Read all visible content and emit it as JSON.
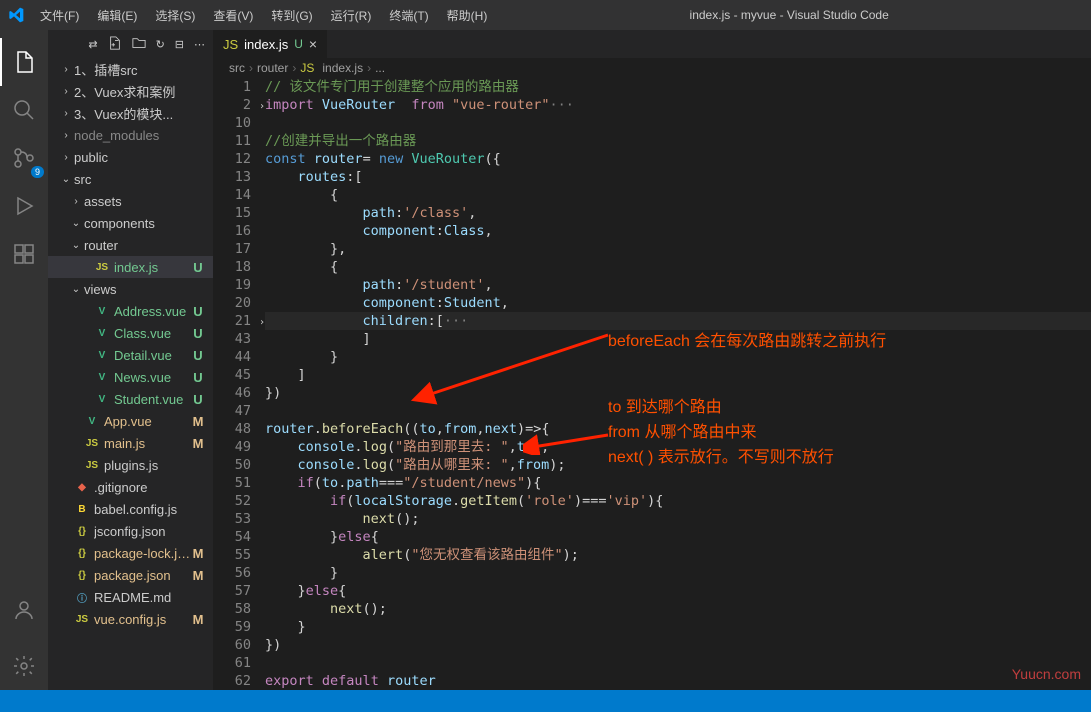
{
  "title": "index.js - myvue - Visual Studio Code",
  "menu": [
    "文件(F)",
    "编辑(E)",
    "选择(S)",
    "查看(V)",
    "转到(G)",
    "运行(R)",
    "终端(T)",
    "帮助(H)"
  ],
  "tab": {
    "label": "index.js",
    "status": "U"
  },
  "breadcrumb": [
    "src",
    "router",
    "index.js",
    "..."
  ],
  "tree": [
    {
      "d": 1,
      "chev": ">",
      "label": "1、插槽src",
      "kind": "folder"
    },
    {
      "d": 1,
      "chev": ">",
      "label": "2、Vuex求和案例",
      "kind": "folder"
    },
    {
      "d": 1,
      "chev": ">",
      "label": "3、Vuex的模块...",
      "kind": "folder"
    },
    {
      "d": 1,
      "chev": ">",
      "label": "node_modules",
      "kind": "folder",
      "dim": true
    },
    {
      "d": 1,
      "chev": ">",
      "label": "public",
      "kind": "folder"
    },
    {
      "d": 1,
      "chev": "v",
      "label": "src",
      "kind": "folder"
    },
    {
      "d": 2,
      "chev": ">",
      "label": "assets",
      "kind": "folder"
    },
    {
      "d": 2,
      "chev": "v",
      "label": "components",
      "kind": "folder"
    },
    {
      "d": 2,
      "chev": "v",
      "label": "router",
      "kind": "folder"
    },
    {
      "d": 3,
      "label": "index.js",
      "kind": "js",
      "st": "U",
      "sel": true
    },
    {
      "d": 2,
      "chev": "v",
      "label": "views",
      "kind": "folder"
    },
    {
      "d": 3,
      "label": "Address.vue",
      "kind": "vue",
      "st": "U"
    },
    {
      "d": 3,
      "label": "Class.vue",
      "kind": "vue",
      "st": "U"
    },
    {
      "d": 3,
      "label": "Detail.vue",
      "kind": "vue",
      "st": "U"
    },
    {
      "d": 3,
      "label": "News.vue",
      "kind": "vue",
      "st": "U"
    },
    {
      "d": 3,
      "label": "Student.vue",
      "kind": "vue",
      "st": "U"
    },
    {
      "d": 2,
      "label": "App.vue",
      "kind": "vue",
      "st": "M"
    },
    {
      "d": 2,
      "label": "main.js",
      "kind": "js",
      "st": "M"
    },
    {
      "d": 2,
      "label": "plugins.js",
      "kind": "js"
    },
    {
      "d": 1,
      "label": ".gitignore",
      "kind": "git"
    },
    {
      "d": 1,
      "label": "babel.config.js",
      "kind": "bab"
    },
    {
      "d": 1,
      "label": "jsconfig.json",
      "kind": "json"
    },
    {
      "d": 1,
      "label": "package-lock.json",
      "kind": "json",
      "st": "M"
    },
    {
      "d": 1,
      "label": "package.json",
      "kind": "json",
      "st": "M"
    },
    {
      "d": 1,
      "label": "README.md",
      "kind": "readme"
    },
    {
      "d": 1,
      "label": "vue.config.js",
      "kind": "js",
      "st": "M"
    }
  ],
  "lineNumbers": [
    "1",
    "2",
    "10",
    "11",
    "12",
    "13",
    "14",
    "15",
    "16",
    "17",
    "18",
    "19",
    "20",
    "21",
    "43",
    "44",
    "45",
    "46",
    "47",
    "48",
    "49",
    "50",
    "51",
    "52",
    "53",
    "54",
    "55",
    "56",
    "57",
    "58",
    "59",
    "60",
    "61",
    "62"
  ],
  "code": [
    {
      "hl": false,
      "html": "<span class='c-comment'>// 该文件专门用于创建整个应用的路由器</span>"
    },
    {
      "hl": false,
      "fold": ">",
      "html": "<span class='c-key'>import</span> <span class='c-var'>VueRouter</span>  <span class='c-key'>from</span> <span class='c-str'>\"vue-router\"</span><span class='c-gray'>···</span>"
    },
    {
      "hl": false,
      "html": ""
    },
    {
      "hl": false,
      "html": "<span class='c-comment'>//创建并导出一个路由器</span>"
    },
    {
      "hl": false,
      "html": "<span class='c-const'>const</span> <span class='c-var'>router</span><span class='c-plain'>= </span><span class='c-const'>new</span> <span class='c-class'>VueRouter</span><span class='c-plain'>({</span>"
    },
    {
      "hl": false,
      "html": "    <span class='c-var'>routes</span><span class='c-plain'>:[</span>"
    },
    {
      "hl": false,
      "html": "        <span class='c-plain'>{</span>"
    },
    {
      "hl": false,
      "html": "            <span class='c-var'>path</span><span class='c-plain'>:</span><span class='c-str'>'/class'</span><span class='c-plain'>,</span>"
    },
    {
      "hl": false,
      "html": "            <span class='c-var'>component</span><span class='c-plain'>:</span><span class='c-var'>Class</span><span class='c-plain'>,</span>"
    },
    {
      "hl": false,
      "html": "        <span class='c-plain'>},</span>"
    },
    {
      "hl": false,
      "html": "        <span class='c-plain'>{</span>"
    },
    {
      "hl": false,
      "html": "            <span class='c-var'>path</span><span class='c-plain'>:</span><span class='c-str'>'/student'</span><span class='c-plain'>,</span>"
    },
    {
      "hl": false,
      "html": "            <span class='c-var'>component</span><span class='c-plain'>:</span><span class='c-var'>Student</span><span class='c-plain'>,</span>"
    },
    {
      "hl": true,
      "fold": ">",
      "html": "            <span class='c-var'>children</span><span class='c-plain'>:[</span><span class='c-gray'>···</span>"
    },
    {
      "hl": false,
      "html": "            <span class='c-plain'>]</span>"
    },
    {
      "hl": false,
      "html": "        <span class='c-plain'>}</span>"
    },
    {
      "hl": false,
      "html": "    <span class='c-plain'>]</span>"
    },
    {
      "hl": false,
      "html": "<span class='c-plain'>})</span>"
    },
    {
      "hl": false,
      "html": ""
    },
    {
      "hl": false,
      "html": "<span class='c-var'>router</span><span class='c-plain'>.</span><span class='c-func'>beforeEach</span><span class='c-plain'>((</span><span class='c-var'>to</span><span class='c-plain'>,</span><span class='c-var'>from</span><span class='c-plain'>,</span><span class='c-var'>next</span><span class='c-plain'>)=&gt;{</span>"
    },
    {
      "hl": false,
      "html": "    <span class='c-var'>console</span><span class='c-plain'>.</span><span class='c-func'>log</span><span class='c-plain'>(</span><span class='c-str'>\"路由到那里去: \"</span><span class='c-plain'>,</span><span class='c-var'>to</span><span class='c-plain'>);</span>"
    },
    {
      "hl": false,
      "html": "    <span class='c-var'>console</span><span class='c-plain'>.</span><span class='c-func'>log</span><span class='c-plain'>(</span><span class='c-str'>\"路由从哪里来: \"</span><span class='c-plain'>,</span><span class='c-var'>from</span><span class='c-plain'>);</span>"
    },
    {
      "hl": false,
      "html": "    <span class='c-key'>if</span><span class='c-plain'>(</span><span class='c-var'>to</span><span class='c-plain'>.</span><span class='c-var'>path</span><span class='c-plain'>===</span><span class='c-str'>\"/student/news\"</span><span class='c-plain'>){</span>"
    },
    {
      "hl": false,
      "html": "        <span class='c-key'>if</span><span class='c-plain'>(</span><span class='c-var'>localStorage</span><span class='c-plain'>.</span><span class='c-func'>getItem</span><span class='c-plain'>(</span><span class='c-str'>'role'</span><span class='c-plain'>)===</span><span class='c-str'>'vip'</span><span class='c-plain'>){</span>"
    },
    {
      "hl": false,
      "html": "            <span class='c-func'>next</span><span class='c-plain'>();</span>"
    },
    {
      "hl": false,
      "html": "        <span class='c-plain'>}</span><span class='c-key'>else</span><span class='c-plain'>{</span>"
    },
    {
      "hl": false,
      "html": "            <span class='c-func'>alert</span><span class='c-plain'>(</span><span class='c-str'>\"您无权查看该路由组件\"</span><span class='c-plain'>);</span>"
    },
    {
      "hl": false,
      "html": "        <span class='c-plain'>}</span>"
    },
    {
      "hl": false,
      "html": "    <span class='c-plain'>}</span><span class='c-key'>else</span><span class='c-plain'>{</span>"
    },
    {
      "hl": false,
      "html": "        <span class='c-func'>next</span><span class='c-plain'>();</span>"
    },
    {
      "hl": false,
      "html": "    <span class='c-plain'>}</span>"
    },
    {
      "hl": false,
      "html": "<span class='c-plain'>})</span>"
    },
    {
      "hl": false,
      "html": ""
    },
    {
      "hl": false,
      "html": "<span class='c-key'>export</span> <span class='c-key'>default</span> <span class='c-var'>router</span>"
    }
  ],
  "annotations": {
    "a1": "beforeEach 会在每次路由跳转之前执行",
    "a2": "to 到达哪个路由",
    "a3": "from  从哪个路由中来",
    "a4": "next( ) 表示放行。不写则不放行"
  },
  "watermark": "Yuucn.com",
  "scm_badge": "9"
}
